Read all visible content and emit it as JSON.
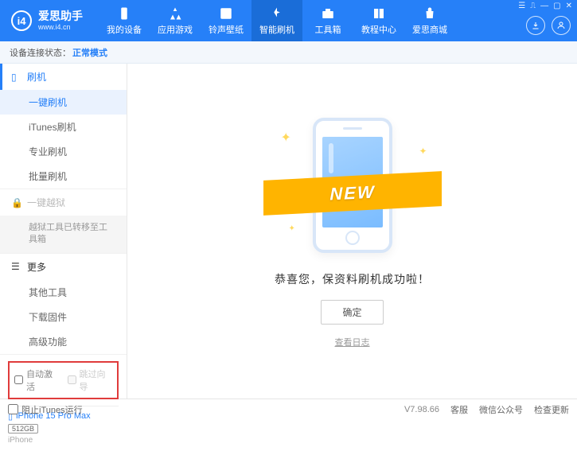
{
  "app": {
    "title": "爱思助手",
    "subtitle": "www.i4.cn"
  },
  "nav": {
    "items": [
      {
        "label": "我的设备"
      },
      {
        "label": "应用游戏"
      },
      {
        "label": "铃声壁纸"
      },
      {
        "label": "智能刷机"
      },
      {
        "label": "工具箱"
      },
      {
        "label": "教程中心"
      },
      {
        "label": "爱思商城"
      }
    ],
    "active_index": 3
  },
  "status": {
    "label": "设备连接状态：",
    "mode": "正常模式"
  },
  "sidebar": {
    "flash": {
      "title": "刷机",
      "items": [
        "一键刷机",
        "iTunes刷机",
        "专业刷机",
        "批量刷机"
      ],
      "active_index": 0
    },
    "jailbreak": {
      "title": "一键越狱",
      "note": "越狱工具已转移至工具箱"
    },
    "more": {
      "title": "更多",
      "items": [
        "其他工具",
        "下载固件",
        "高级功能"
      ]
    },
    "checkboxes": {
      "auto_activate": "自动激活",
      "skip_guide": "跳过向导"
    },
    "device": {
      "name": "iPhone 15 Pro Max",
      "storage": "512GB",
      "type": "iPhone"
    }
  },
  "main": {
    "ribbon": "NEW",
    "message": "恭喜您，保资料刷机成功啦！",
    "ok": "确定",
    "log": "查看日志"
  },
  "footer": {
    "block_itunes": "阻止iTunes运行",
    "version": "V7.98.66",
    "links": [
      "客服",
      "微信公众号",
      "检查更新"
    ]
  }
}
